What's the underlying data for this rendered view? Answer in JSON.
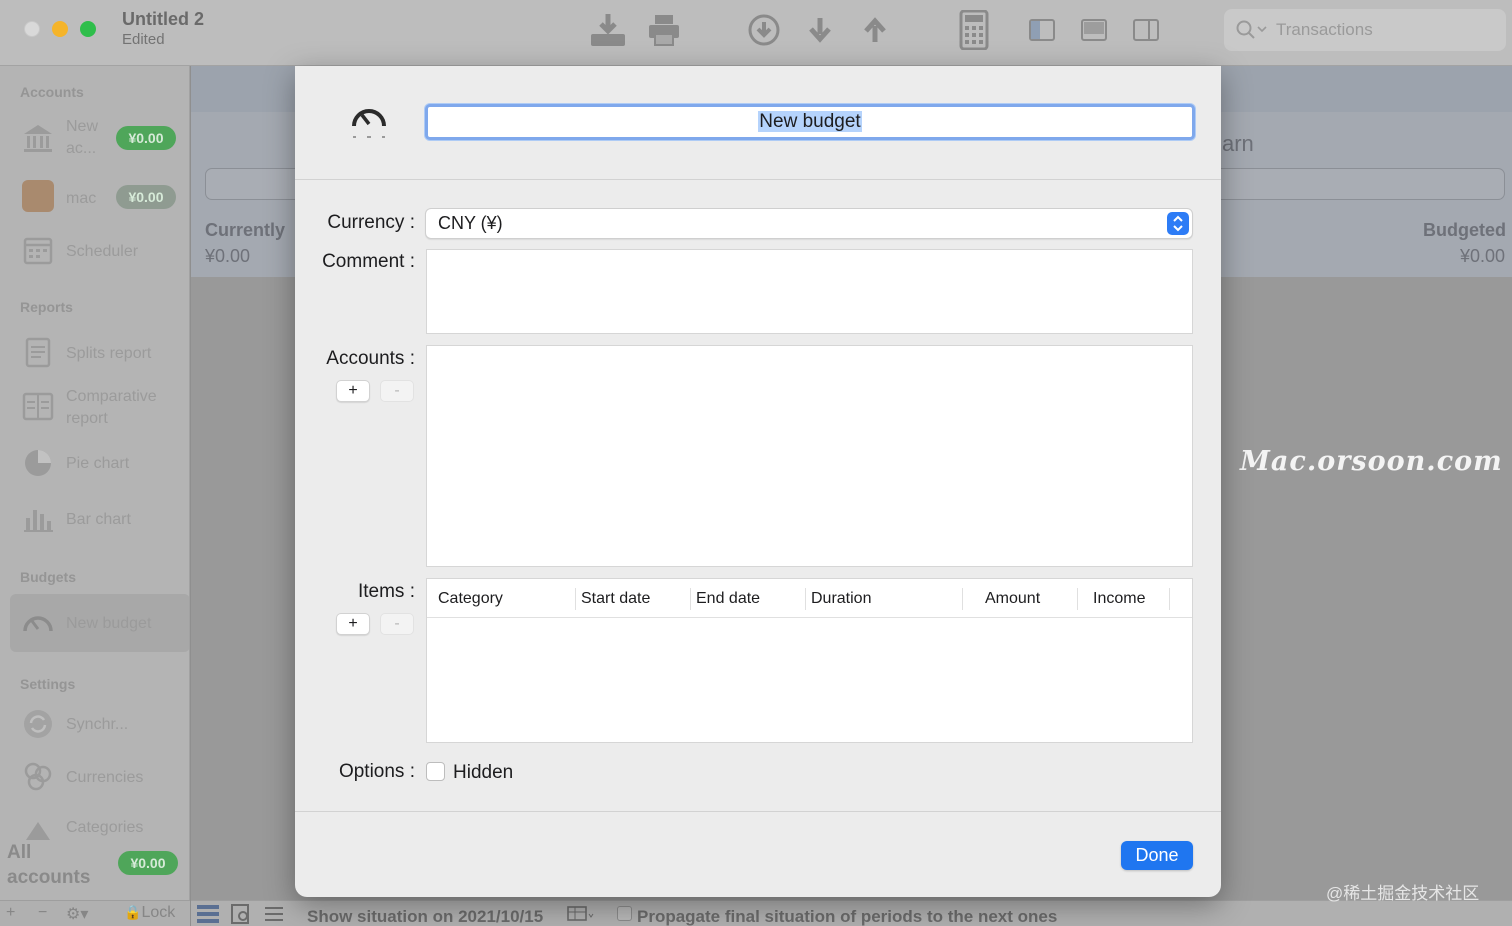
{
  "window": {
    "title": "Untitled 2",
    "subtitle": "Edited"
  },
  "toolbar": {
    "icons": [
      "import-icon",
      "print-icon",
      "download-circle-icon",
      "arrow-down-icon",
      "arrow-up-icon",
      "calculator-icon",
      "left-panel-icon",
      "center-panel-icon",
      "right-panel-icon"
    ],
    "search_placeholder": "Transactions"
  },
  "sidebar": {
    "accounts_header": "Accounts",
    "accounts": [
      {
        "label": "New ac...",
        "line1": "New",
        "line2": "ac...",
        "balance": "¥0.00"
      },
      {
        "label": "mac",
        "balance": "¥0.00"
      }
    ],
    "scheduler": "Scheduler",
    "reports_header": "Reports",
    "reports": [
      "Splits report",
      "Comparative report",
      "Pie chart",
      "Bar chart"
    ],
    "comparative_line1": "Comparative",
    "comparative_line2": "report",
    "budgets_header": "Budgets",
    "budgets": [
      "New budget"
    ],
    "settings_header": "Settings",
    "settings": [
      "Synchr...",
      "Currencies",
      "Categories"
    ],
    "all_accounts_line1": "All",
    "all_accounts_line2": "accounts",
    "all_accounts_balance": "¥0.00",
    "footer": {
      "add": "+",
      "remove": "−",
      "lock": "Lock"
    }
  },
  "main": {
    "currently_label": "Currently",
    "currently_value": "¥0.00",
    "budgeted_label": "Budgeted",
    "budgeted_value": "¥0.00",
    "partial_heading": "arn",
    "bottom_situation": "Show situation on 2021/10/15",
    "propagate": "Propagate final situation of periods to the next ones"
  },
  "sheet": {
    "name_value": "New budget",
    "currency_label": "Currency :",
    "currency_value": "CNY (¥)",
    "comment_label": "Comment :",
    "accounts_label": "Accounts :",
    "items_label": "Items :",
    "add_label": "+",
    "remove_label": "-",
    "items_columns": [
      "Category",
      "Start date",
      "End date",
      "Duration",
      "Amount",
      "Income"
    ],
    "options_label": "Options :",
    "hidden_label": "Hidden",
    "hidden_checked": false,
    "done_label": "Done"
  },
  "overlay": {
    "watermark": "Mac.orsoon.com",
    "credit": "@稀土掘金技术社区"
  },
  "colors": {
    "accent": "#1f76f0",
    "balance_green": "#4fa65a",
    "selection": "#b5d3fc"
  }
}
